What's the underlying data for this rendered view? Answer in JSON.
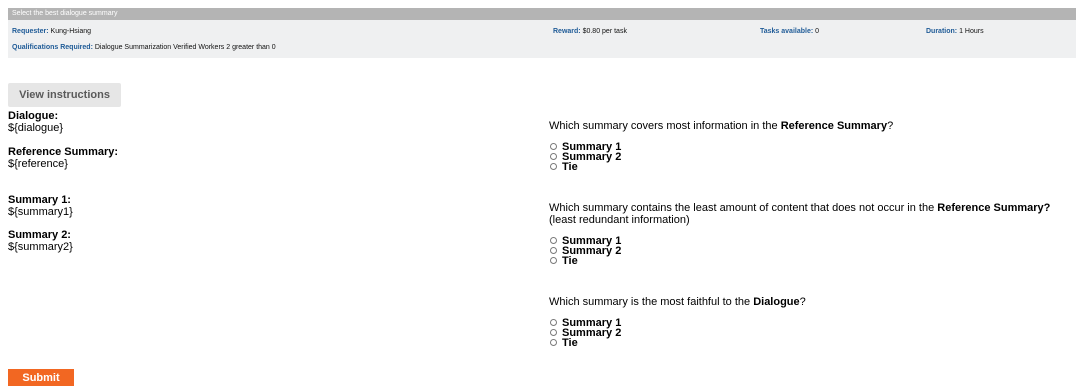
{
  "hit": {
    "title": "Select the best dialogue summary",
    "requester_label": "Requester:",
    "requester_value": "Kung-Hsiang",
    "reward_label": "Reward:",
    "reward_value": "$0.80 per task",
    "tasks_label": "Tasks available:",
    "tasks_value": "0",
    "duration_label": "Duration:",
    "duration_value": "1 Hours",
    "qualifications_label": "Qualifications Required:",
    "qualifications_value": "Dialogue Summarization Verified Workers 2 greater than 0"
  },
  "view_instructions_label": "View instructions",
  "fields": {
    "dialogue_label": "Dialogue:",
    "dialogue_value": "${dialogue}",
    "reference_label": "Reference Summary:",
    "reference_value": "${reference}",
    "summary1_label": "Summary 1:",
    "summary1_value": "${summary1}",
    "summary2_label": "Summary 2:",
    "summary2_value": "${summary2}"
  },
  "questions": [
    {
      "text_before": "Which summary covers most information in the ",
      "text_bold": "Reference Summary",
      "text_after": "?",
      "options": [
        "Summary 1",
        "Summary 2",
        "Tie"
      ]
    },
    {
      "text_before": "Which summary contains the least amount of content that does not occur in the ",
      "text_bold": "Reference Summary?",
      "text_after": " (least redundant information)",
      "options": [
        "Summary 1",
        "Summary 2",
        "Tie"
      ]
    },
    {
      "text_before": "Which summary is the most faithful to the ",
      "text_bold": "Dialogue",
      "text_after": "?",
      "options": [
        "Summary 1",
        "Summary 2",
        "Tie"
      ]
    }
  ],
  "submit_label": "Submit",
  "colors": {
    "title_bar": "#b4b4b4",
    "info_bg": "#eff0f1",
    "label_blue": "#1f5b97",
    "submit_orange": "#f26722"
  }
}
